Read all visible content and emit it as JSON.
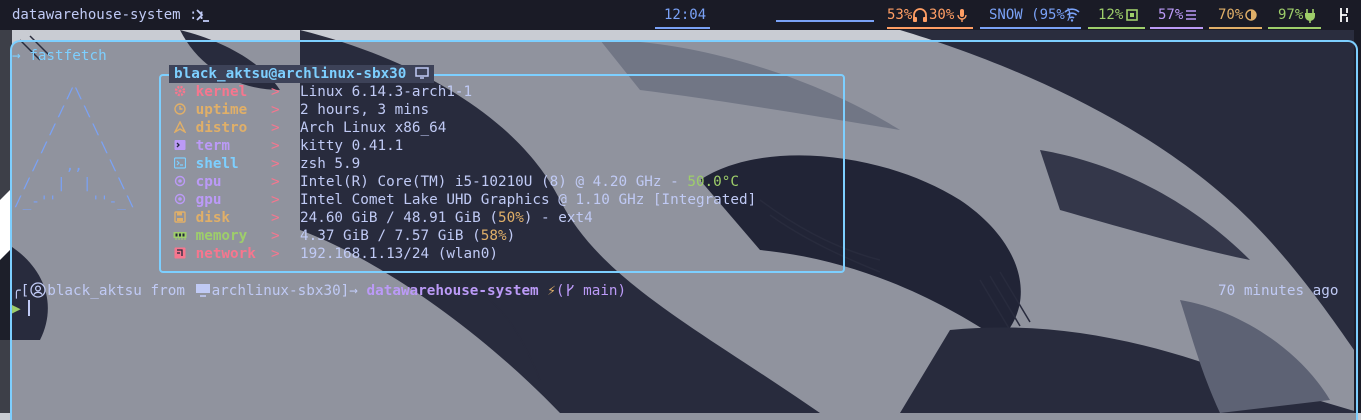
{
  "topbar": {
    "workspace": "datawarehouse-system ::",
    "prompt_icon": "terminal-prompt-icon",
    "clock": "12:04",
    "cpu_percent": "53%",
    "headphone_volume": "30%",
    "mic_icon": "microphone-icon",
    "wifi_label": "SNOW (95%)",
    "cpu_load": "12%",
    "memory": "57%",
    "brightness": "70%",
    "battery": "97%",
    "power_icon": "power-icon",
    "colors": {
      "bg": "#1a1b26",
      "orange": "#ff9e64",
      "blue": "#7aa2f7",
      "green": "#9ece6a",
      "purple": "#bb9af7",
      "yellow": "#e0af68"
    }
  },
  "terminal": {
    "command_line": "→ fastfetch",
    "logo_lines": [
      "      /\\",
      "     /  \\",
      "    /    \\",
      "   /      \\",
      "  /   ,,   \\",
      " /   |  |   \\",
      "/_-''    ''-_\\"
    ],
    "box_title": "black_aktsu@archlinux-sbx30",
    "box_title_icon": "monitor-icon",
    "info": [
      {
        "icon": "gear-icon",
        "key": "kernel",
        "sep": ">",
        "value": "Linux 6.14.3-arch1-1"
      },
      {
        "icon": "clock-icon",
        "key": "uptime",
        "sep": ">",
        "value": "2 hours, 3 mins"
      },
      {
        "icon": "arch-icon",
        "key": "distro",
        "sep": ">",
        "value": "Arch Linux x86_64"
      },
      {
        "icon": "terminal-icon",
        "key": "term",
        "sep": ">",
        "value": "kitty 0.41.1"
      },
      {
        "icon": "shell-icon",
        "key": "shell",
        "sep": ">",
        "value": "zsh 5.9"
      },
      {
        "icon": "cpu-icon",
        "key": "cpu",
        "sep": ">",
        "value": "Intel(R) Core(TM) i5-10210U (8) @ 4.20 GHz - ",
        "extra": "50.0°C"
      },
      {
        "icon": "gpu-icon",
        "key": "gpu",
        "sep": ">",
        "value": "Intel Comet Lake UHD Graphics @ 1.10 GHz [Integrated]"
      },
      {
        "icon": "disk-icon",
        "key": "disk",
        "sep": ">",
        "value": "24.60 GiB / 48.91 GiB (",
        "extra": "50%",
        "value_after": ") - ext4"
      },
      {
        "icon": "memory-icon",
        "key": "memory",
        "sep": ">",
        "value": "4.37 GiB / 7.57 GiB (",
        "extra": "58%",
        "value_after": ")"
      },
      {
        "icon": "network-icon",
        "key": "network",
        "sep": ">",
        "value": "192.168.1.13/24 (wlan0)"
      }
    ],
    "prompt": {
      "corner": "╭[",
      "user": "black_aktsu",
      "from": " from ",
      "host": "archlinux-sbx30]",
      "arrow": "→ ",
      "dir": "datawarehouse-system",
      "bolt": " ⚡",
      "git_open": "(",
      "git_branch_icon": "git-branch-icon",
      "branch": " main)",
      "time_ago": "70 minutes ago",
      "second_line_symbol": "▶"
    }
  }
}
